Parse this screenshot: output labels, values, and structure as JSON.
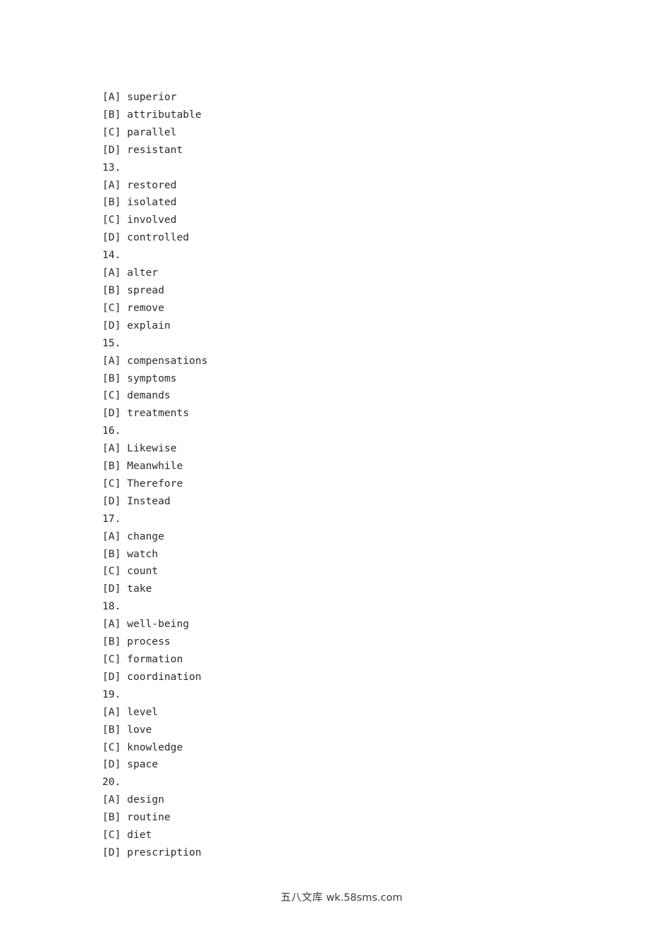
{
  "document": {
    "type": "exam-answer-options-list",
    "text_color": "#2b2b2b",
    "background_color": "#ffffff",
    "lines": [
      {
        "kind": "option",
        "tag": "[A]",
        "text": "superior"
      },
      {
        "kind": "option",
        "tag": "[B]",
        "text": "attributable"
      },
      {
        "kind": "option",
        "tag": "[C]",
        "text": "parallel"
      },
      {
        "kind": "option",
        "tag": "[D]",
        "text": "resistant"
      },
      {
        "kind": "question",
        "tag": "",
        "text": "13."
      },
      {
        "kind": "option",
        "tag": "[A]",
        "text": "restored"
      },
      {
        "kind": "option",
        "tag": "[B]",
        "text": "isolated"
      },
      {
        "kind": "option",
        "tag": "[C]",
        "text": "involved"
      },
      {
        "kind": "option",
        "tag": "[D]",
        "text": "controlled"
      },
      {
        "kind": "question",
        "tag": "",
        "text": "14."
      },
      {
        "kind": "option",
        "tag": "[A]",
        "text": "alter"
      },
      {
        "kind": "option",
        "tag": "[B]",
        "text": "spread"
      },
      {
        "kind": "option",
        "tag": "[C]",
        "text": "remove"
      },
      {
        "kind": "option",
        "tag": "[D]",
        "text": "explain"
      },
      {
        "kind": "question",
        "tag": "",
        "text": "15."
      },
      {
        "kind": "option",
        "tag": "[A]",
        "text": "compensations"
      },
      {
        "kind": "option",
        "tag": "[B]",
        "text": "symptoms"
      },
      {
        "kind": "option",
        "tag": "[C]",
        "text": "demands"
      },
      {
        "kind": "option",
        "tag": "[D]",
        "text": "treatments"
      },
      {
        "kind": "question",
        "tag": "",
        "text": "16."
      },
      {
        "kind": "option",
        "tag": "[A]",
        "text": "Likewise"
      },
      {
        "kind": "option",
        "tag": "[B]",
        "text": "Meanwhile"
      },
      {
        "kind": "option",
        "tag": "[C]",
        "text": "Therefore"
      },
      {
        "kind": "option",
        "tag": "[D]",
        "text": "Instead"
      },
      {
        "kind": "question",
        "tag": "",
        "text": "17."
      },
      {
        "kind": "option",
        "tag": "[A]",
        "text": "change"
      },
      {
        "kind": "option",
        "tag": "[B]",
        "text": "watch"
      },
      {
        "kind": "option",
        "tag": "[C]",
        "text": "count"
      },
      {
        "kind": "option",
        "tag": "[D]",
        "text": "take"
      },
      {
        "kind": "question",
        "tag": "",
        "text": "18."
      },
      {
        "kind": "option",
        "tag": "[A]",
        "text": "well-being"
      },
      {
        "kind": "option",
        "tag": "[B]",
        "text": "process"
      },
      {
        "kind": "option",
        "tag": "[C]",
        "text": "formation"
      },
      {
        "kind": "option",
        "tag": "[D]",
        "text": "coordination"
      },
      {
        "kind": "question",
        "tag": "",
        "text": "19."
      },
      {
        "kind": "option",
        "tag": "[A]",
        "text": "level"
      },
      {
        "kind": "option",
        "tag": "[B]",
        "text": "love"
      },
      {
        "kind": "option",
        "tag": "[C]",
        "text": "knowledge"
      },
      {
        "kind": "option",
        "tag": "[D]",
        "text": "space"
      },
      {
        "kind": "question",
        "tag": "",
        "text": "20."
      },
      {
        "kind": "option",
        "tag": "[A]",
        "text": "design"
      },
      {
        "kind": "option",
        "tag": "[B]",
        "text": "routine"
      },
      {
        "kind": "option",
        "tag": "[C]",
        "text": "diet"
      },
      {
        "kind": "option",
        "tag": "[D]",
        "text": "prescription"
      }
    ]
  },
  "watermark": {
    "brand_cn": "五八文库",
    "url": "wk.58sms.com"
  }
}
